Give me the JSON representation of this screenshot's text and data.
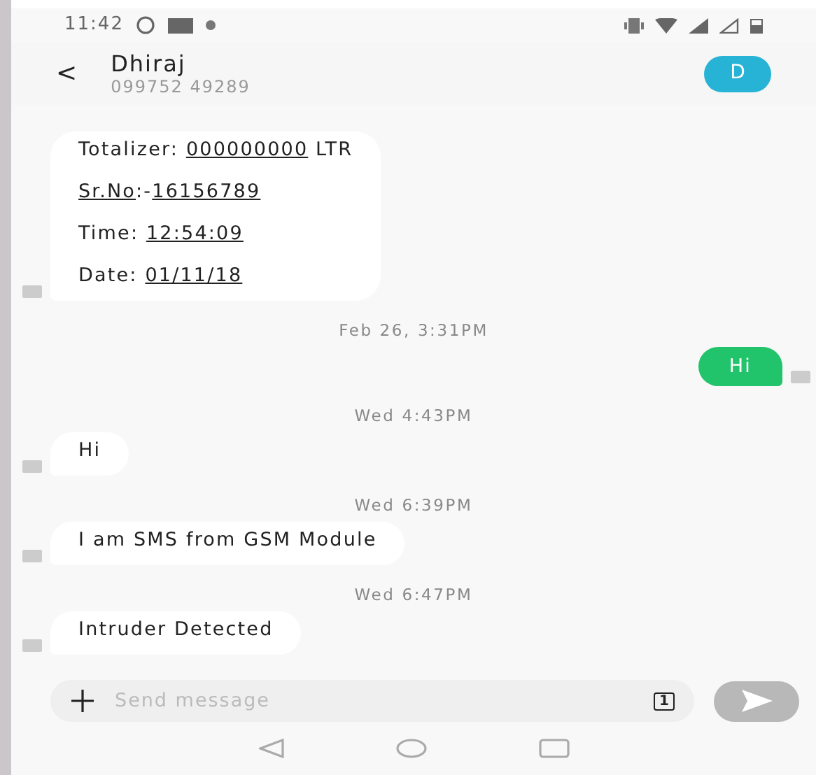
{
  "status_bar": {
    "time": "11:42"
  },
  "header": {
    "back_glyph": "<",
    "name": "Dhiraj",
    "number": "099752 49289",
    "avatar_letter": "D"
  },
  "conversation": [
    {
      "kind": "received",
      "lines": [
        [
          {
            "kind": "text",
            "text": "Totalizer: "
          },
          {
            "kind": "link",
            "text": "000000000"
          },
          {
            "kind": "text",
            "text": " LTR"
          }
        ],
        [
          {
            "kind": "link",
            "text": "Sr.No"
          },
          {
            "kind": "text",
            "text": ":-"
          },
          {
            "kind": "link",
            "text": "16156789"
          }
        ],
        [
          {
            "kind": "text",
            "text": "Time: "
          },
          {
            "kind": "link",
            "text": "12:54:09"
          }
        ],
        [
          {
            "kind": "text",
            "text": "Date: "
          },
          {
            "kind": "link",
            "text": "01/11/18"
          }
        ]
      ]
    },
    {
      "kind": "timestamp",
      "text": "Feb 26, 3:31PM"
    },
    {
      "kind": "sent",
      "lines": [
        [
          {
            "kind": "text",
            "text": "Hi"
          }
        ]
      ]
    },
    {
      "kind": "timestamp",
      "text": "Wed 4:43PM"
    },
    {
      "kind": "received",
      "lines": [
        [
          {
            "kind": "text",
            "text": "Hi"
          }
        ]
      ]
    },
    {
      "kind": "timestamp",
      "text": "Wed 6:39PM"
    },
    {
      "kind": "received",
      "lines": [
        [
          {
            "kind": "text",
            "text": "I am SMS from GSM Module"
          }
        ]
      ]
    },
    {
      "kind": "timestamp",
      "text": "Wed 6:47PM"
    },
    {
      "kind": "received",
      "lines": [
        [
          {
            "kind": "text",
            "text": "Intruder Detected"
          }
        ]
      ]
    }
  ],
  "composer": {
    "placeholder": "Send message",
    "sim_number": "1"
  }
}
